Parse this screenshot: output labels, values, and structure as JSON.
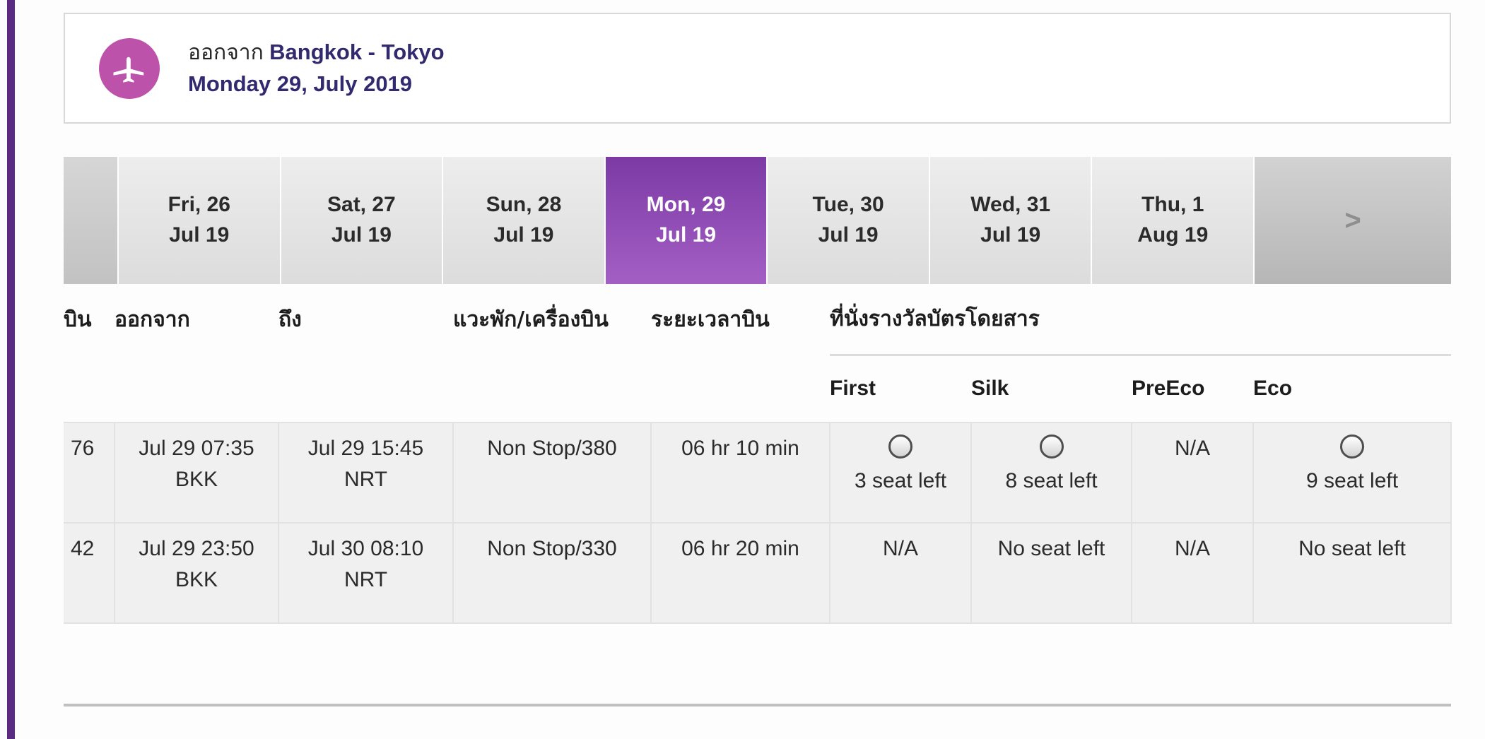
{
  "route_header": {
    "icon": "airplane-icon",
    "departure_label": "ออกจาก",
    "cities": "Bangkok - Tokyo",
    "date": "Monday 29, July 2019",
    "accent_color": "#322a6e",
    "badge_color": "#bd52ab"
  },
  "date_strip": {
    "selected_color": "#7c3aa5",
    "next_label": ">",
    "tabs": [
      {
        "day": "Fri, 26",
        "date": "Jul 19",
        "selected": false
      },
      {
        "day": "Sat, 27",
        "date": "Jul 19",
        "selected": false
      },
      {
        "day": "Sun, 28",
        "date": "Jul 19",
        "selected": false
      },
      {
        "day": "Mon, 29",
        "date": "Jul 19",
        "selected": true
      },
      {
        "day": "Tue, 30",
        "date": "Jul 19",
        "selected": false
      },
      {
        "day": "Wed, 31",
        "date": "Jul 19",
        "selected": false
      },
      {
        "day": "Thu, 1",
        "date": "Aug 19",
        "selected": false
      }
    ]
  },
  "table": {
    "headers": {
      "flight": "บิน",
      "depart": "ออกจาก",
      "arrive": "ถึง",
      "stops": "แวะพัก/เครื่องบิน",
      "duration": "ระยะเวลาบิน",
      "award_group": "ที่นั่งรางวัลบัตรโดยสาร"
    },
    "cabin_classes": [
      "First",
      "Silk",
      "PreEco",
      "Eco"
    ],
    "rows": [
      {
        "flight_no": "76",
        "depart_time": "Jul 29 07:35",
        "depart_airport": "BKK",
        "arrive_time": "Jul 29 15:45",
        "arrive_airport": "NRT",
        "stops": "Non Stop/380",
        "duration": "06 hr 10 min",
        "cabins": [
          {
            "class": "First",
            "selectable": true,
            "label": "3 seat left"
          },
          {
            "class": "Silk",
            "selectable": true,
            "label": "8 seat left"
          },
          {
            "class": "PreEco",
            "selectable": false,
            "label": "N/A"
          },
          {
            "class": "Eco",
            "selectable": true,
            "label": "9 seat left"
          }
        ]
      },
      {
        "flight_no": "42",
        "depart_time": "Jul 29 23:50",
        "depart_airport": "BKK",
        "arrive_time": "Jul 30 08:10",
        "arrive_airport": "NRT",
        "stops": "Non Stop/330",
        "duration": "06 hr 20 min",
        "cabins": [
          {
            "class": "First",
            "selectable": false,
            "label": "N/A"
          },
          {
            "class": "Silk",
            "selectable": false,
            "label": "No seat left"
          },
          {
            "class": "PreEco",
            "selectable": false,
            "label": "N/A"
          },
          {
            "class": "Eco",
            "selectable": false,
            "label": "No seat left"
          }
        ]
      }
    ]
  }
}
